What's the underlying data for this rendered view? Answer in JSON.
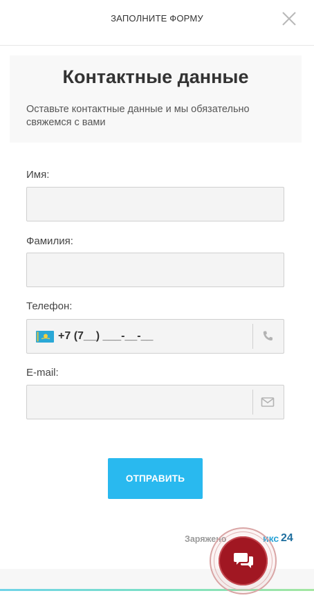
{
  "header": {
    "title": "ЗАПОЛНИТЕ ФОРМУ",
    "close_icon": "close-icon"
  },
  "info": {
    "title": "Контактные данные",
    "text": "Оставьте контактные данные и мы обязательно свяжемся с вами"
  },
  "form": {
    "first_name": {
      "label": "Имя:",
      "value": ""
    },
    "last_name": {
      "label": "Фамилия:",
      "value": ""
    },
    "phone": {
      "label": "Телефон:",
      "value": "+7 (7__) ___-__-__",
      "flag": "kazakhstan-flag-icon",
      "icon": "phone-icon"
    },
    "email": {
      "label": "E-mail:",
      "value": "",
      "icon": "envelope-icon"
    },
    "submit_label": "ОТПРАВИТЬ"
  },
  "footer": {
    "powered_text": "Заряжено",
    "brand": "икс",
    "brand_num": "24"
  },
  "chat": {
    "icon": "chat-bubbles-icon",
    "color": "#a11722"
  },
  "colors": {
    "accent": "#29b9ef",
    "field_bg": "#f4f4f4",
    "field_border": "#cfcfcf"
  }
}
